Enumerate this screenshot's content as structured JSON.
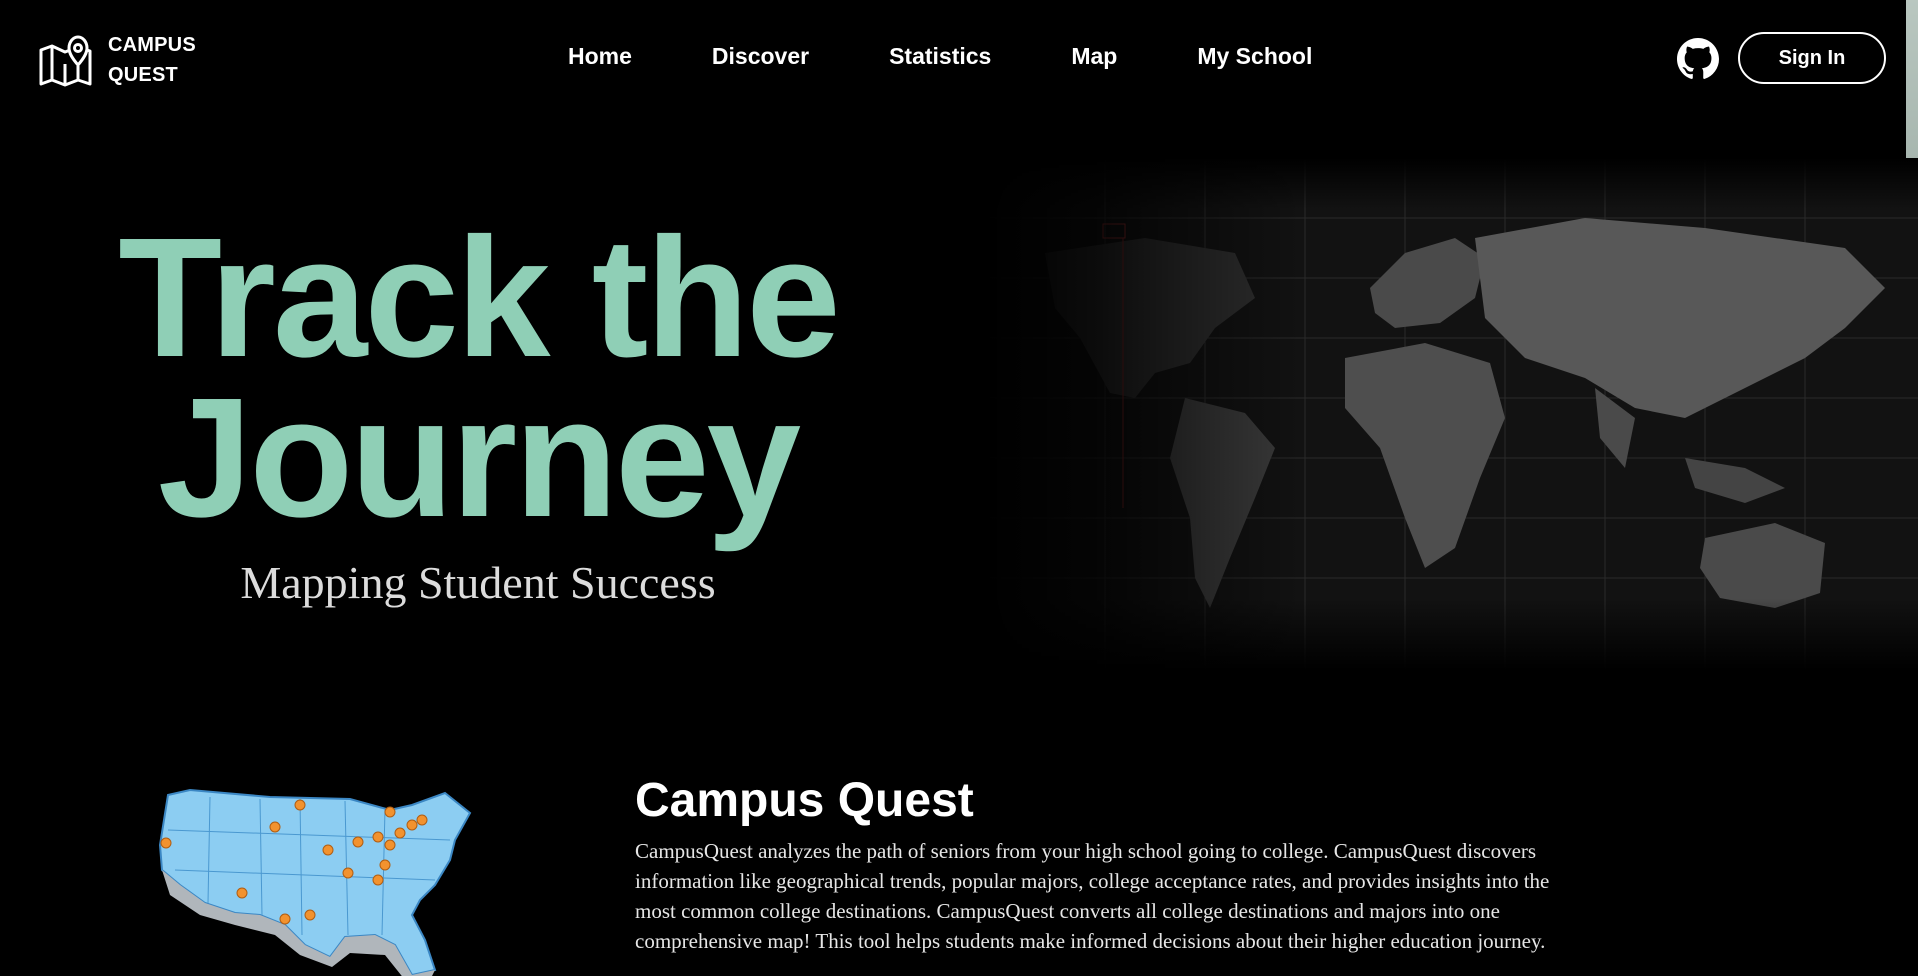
{
  "brand": {
    "line1": "CAMPUS",
    "line2": "QUEST",
    "icon": "map-pin-icon"
  },
  "nav": {
    "items": [
      "Home",
      "Discover",
      "Statistics",
      "Map",
      "My School"
    ]
  },
  "header": {
    "github_icon": "github-icon",
    "signin_label": "Sign In"
  },
  "hero": {
    "title_line1": "Track the",
    "title_line2": "Journey",
    "subtitle": "Mapping Student Success",
    "title_color": "#8fcfb6"
  },
  "about": {
    "title": "Campus Quest",
    "body": "CampusQuest analyzes the path of seniors from your high school going to college. CampusQuest discovers information like geographical trends, popular majors, college acceptance rates, and provides insights into the most common college destinations. CampusQuest converts all college destinations and majors into one comprehensive map! This tool helps students make informed decisions about their higher education journey."
  },
  "colors": {
    "background": "#000000",
    "accent": "#8fcfb6",
    "marker": "#f2922e"
  }
}
